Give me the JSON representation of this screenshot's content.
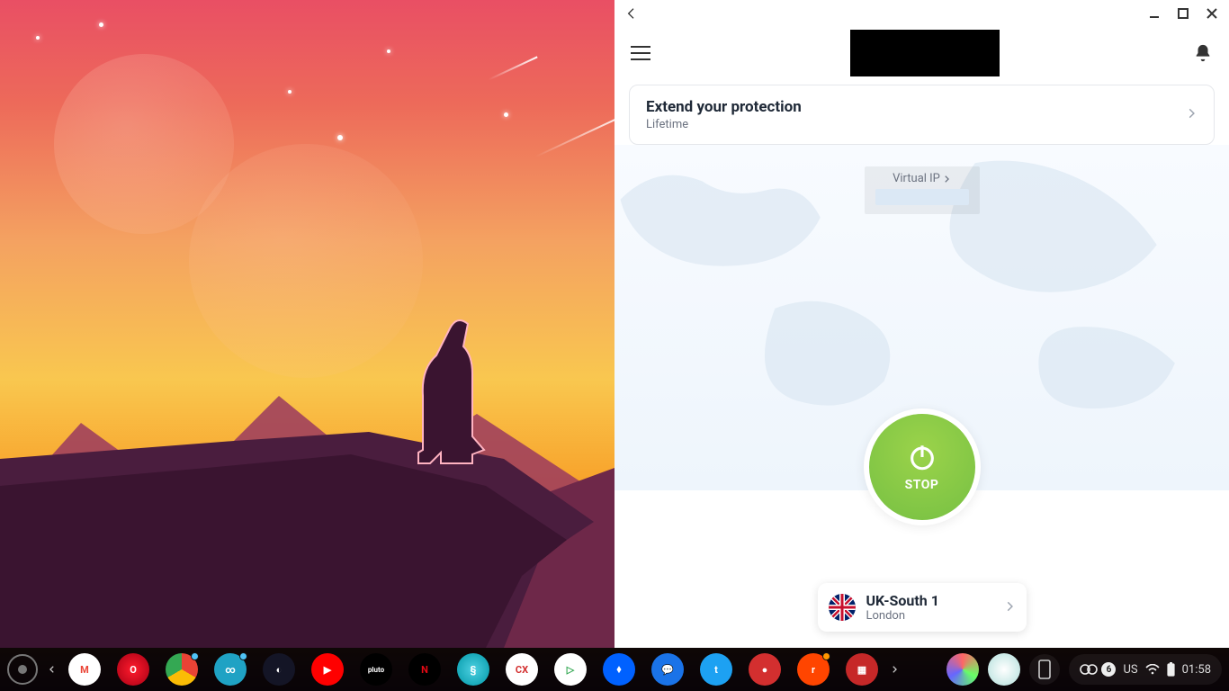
{
  "vpn": {
    "promo": {
      "title": "Extend your protection",
      "subtitle": "Lifetime"
    },
    "virtual_ip_label": "Virtual IP",
    "power_label": "STOP",
    "server": {
      "name": "UK-South 1",
      "city": "London",
      "country": "UK"
    }
  },
  "shelf": {
    "apps": [
      {
        "name": "gmail",
        "bg": "#fff",
        "letter": "M",
        "color": "#ea4335"
      },
      {
        "name": "opera",
        "bg": "radial-gradient(circle,#ff1b2d,#a70014)",
        "letter": "O"
      },
      {
        "name": "chrome",
        "bg": "conic-gradient(#ea4335 0 120deg,#fbbc05 120deg 240deg,#34a853 240deg 360deg)",
        "letter": "",
        "badge": true
      },
      {
        "name": "vpn-app",
        "bg": "#1fa2c4",
        "letter": "∞",
        "badge": true
      },
      {
        "name": "speedtest",
        "bg": "#141526",
        "letter": "◐"
      },
      {
        "name": "youtube",
        "bg": "#ff0000",
        "letter": "▶"
      },
      {
        "name": "pluto-tv",
        "bg": "#000",
        "letter": "pluto",
        "small": true
      },
      {
        "name": "netflix",
        "bg": "#000",
        "letter": "N",
        "color": "#e50914"
      },
      {
        "name": "seahorse",
        "bg": "radial-gradient(circle,#4dd0e1,#0097a7)",
        "letter": "§"
      },
      {
        "name": "cx",
        "bg": "#fff",
        "letter": "CX",
        "color": "#d32f2f"
      },
      {
        "name": "play-store",
        "bg": "#fff",
        "letter": "▷",
        "color": "#34a853"
      },
      {
        "name": "dropbox",
        "bg": "#0061ff",
        "letter": "⬧"
      },
      {
        "name": "messages",
        "bg": "#1a73e8",
        "letter": "💬"
      },
      {
        "name": "twitter",
        "bg": "#1da1f2",
        "letter": "t"
      },
      {
        "name": "red-app",
        "bg": "#d32f2f",
        "letter": "●"
      },
      {
        "name": "reddit",
        "bg": "#ff4500",
        "letter": "r",
        "badge": true,
        "badgeWarn": true
      },
      {
        "name": "red-square",
        "bg": "#c62828",
        "letter": "▦"
      }
    ],
    "status": {
      "count_badge": "6",
      "keyboard": "US",
      "time": "01:58"
    }
  }
}
